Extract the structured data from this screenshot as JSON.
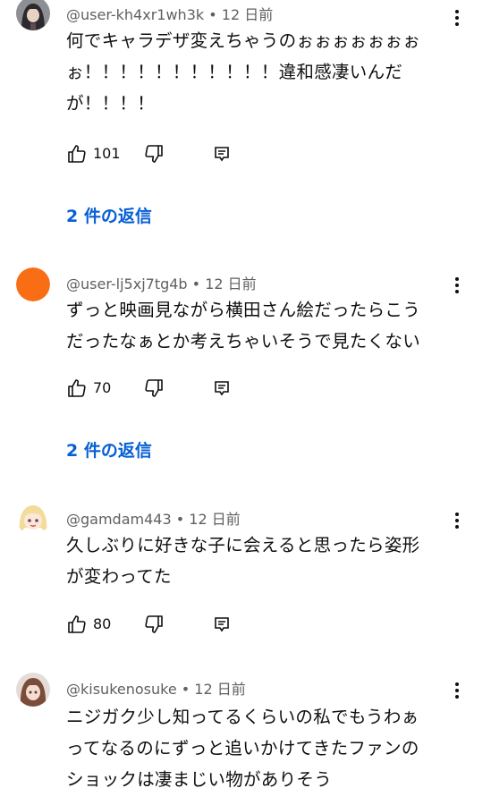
{
  "comments": [
    {
      "author": "@user-kh4xr1wh3k",
      "time": "• 12 日前",
      "lines": [
        "何でキャラデザ変えちゃうのぉぉぉぉぉぉぉ",
        "ぉ！！！！！！！！！！！違和感凄いんだ",
        "が！！！！"
      ],
      "likes": "101",
      "replies": "2 件の返信",
      "avatar": "dark-character-avatar"
    },
    {
      "author": "@user-lj5xj7tg4b",
      "time": "• 12 日前",
      "lines": [
        "ずっと映画見ながら横田さん絵だったらこう",
        "だったなぁとか考えちゃいそうで見たくない"
      ],
      "likes": "70",
      "replies": "2 件の返信",
      "avatar": "orange-circle-avatar",
      "avatar_color": "#f96d15"
    },
    {
      "author": "@gamdam443",
      "time": "• 12 日前",
      "lines": [
        "久しぶりに好きな子に会えると思ったら姿形",
        "が変わってた"
      ],
      "likes": "80",
      "avatar": "blonde-character-avatar"
    },
    {
      "author": "@kisukenosuke",
      "time": "• 12 日前",
      "lines": [
        "ニジガク少し知ってるくらいの私でもうわぁ",
        "ってなるのにずっと追いかけてきたファンの",
        "ショックは凄まじい物がありそう"
      ],
      "avatar": "brown-hair-character-avatar"
    }
  ],
  "colors": {
    "link": "#065fd4",
    "meta": "#606060",
    "text": "#0f0f0f"
  }
}
